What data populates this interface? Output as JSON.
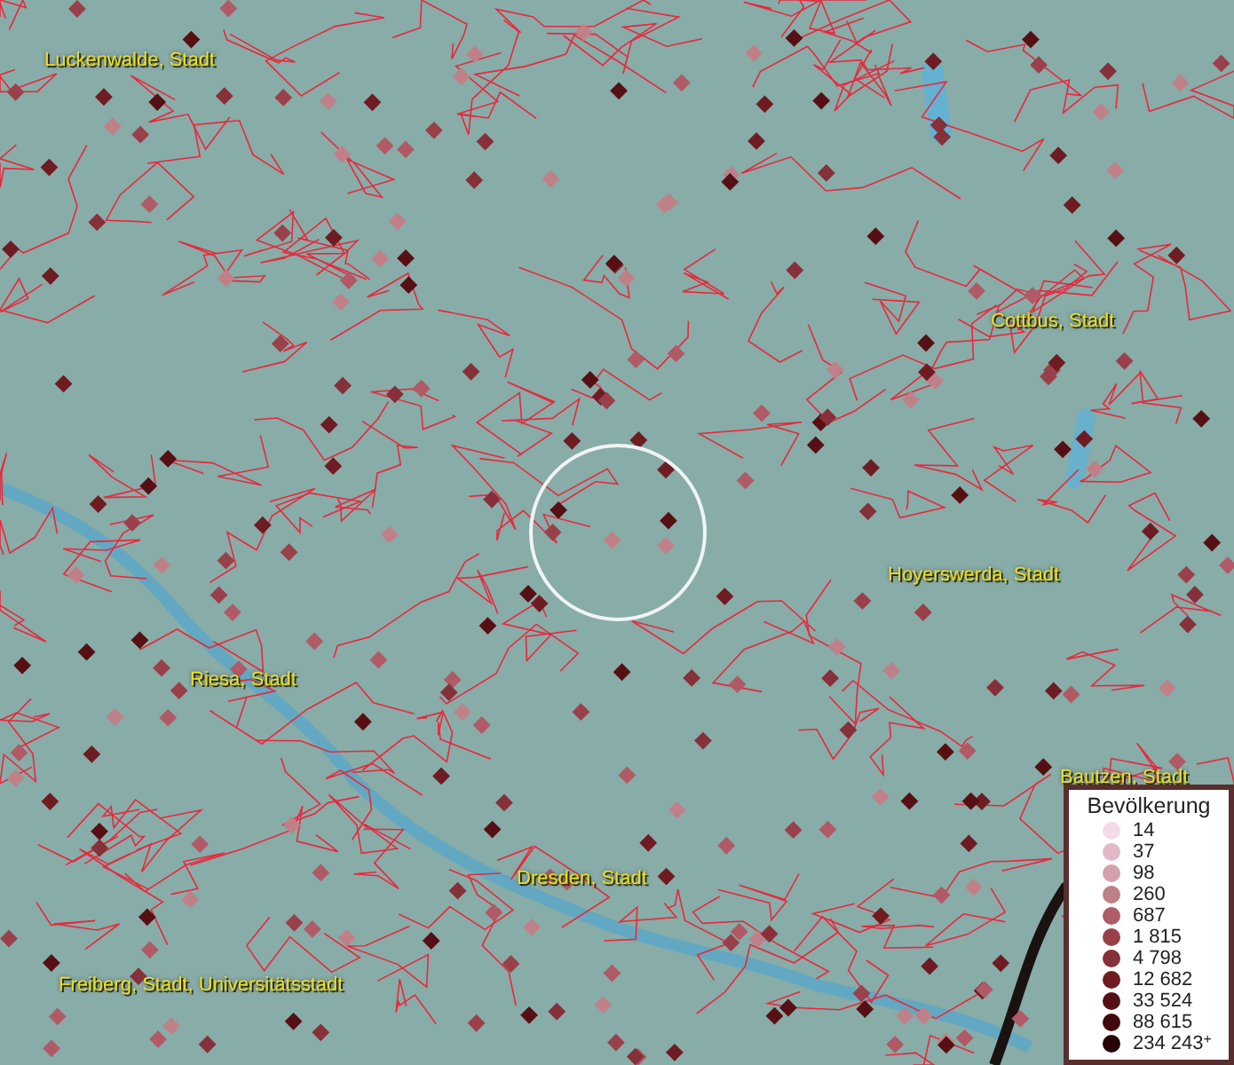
{
  "map": {
    "labels": [
      {
        "text": "Luckenwalde, Stadt"
      },
      {
        "text": "Cottbus, Stadt"
      },
      {
        "text": "Hoyerswerda, Stadt"
      },
      {
        "text": "Riesa, Stadt"
      },
      {
        "text": "Bautzen, Stadt"
      },
      {
        "text": "Dresden, Stadt"
      },
      {
        "text": "Freiberg, Stadt, Universitätsstadt"
      }
    ]
  },
  "legend": {
    "title": "Bevölkerung",
    "classes": [
      {
        "label": "14",
        "color": "#f3dbe8"
      },
      {
        "label": "37",
        "color": "#e3b8c6"
      },
      {
        "label": "98",
        "color": "#d4a0ac"
      },
      {
        "label": "260",
        "color": "#c08088"
      },
      {
        "label": "687",
        "color": "#ad5e68"
      },
      {
        "label": "1 815",
        "color": "#9a404a"
      },
      {
        "label": "4 798",
        "color": "#86303a"
      },
      {
        "label": "12 682",
        "color": "#6e1c22"
      },
      {
        "label": "33 524",
        "color": "#561014"
      },
      {
        "label": "88 615",
        "color": "#400a0c"
      },
      {
        "label": "234 243$^{+}$",
        "color": "#260406"
      }
    ]
  }
}
